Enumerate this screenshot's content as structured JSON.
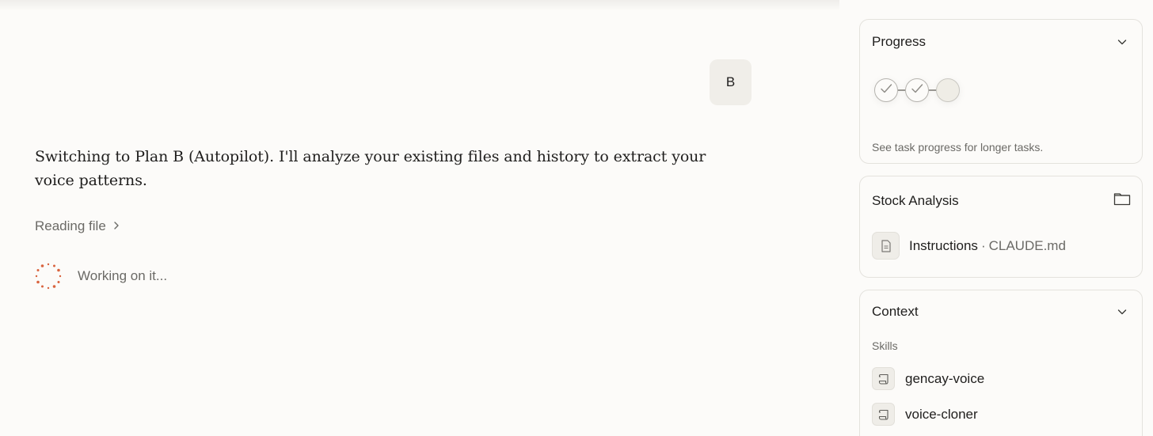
{
  "chat": {
    "user_message": "B",
    "assistant_message": "Switching to Plan B (Autopilot). I'll analyze your existing files and history to extract your voice patterns.",
    "tool_call_label": "Reading file",
    "status_text": "Working on it..."
  },
  "progress_panel": {
    "title": "Progress",
    "steps": [
      "complete",
      "complete",
      "pending"
    ],
    "hint": "See task progress for longer tasks."
  },
  "project_panel": {
    "title": "Stock Analysis",
    "file": {
      "name": "Instructions",
      "separator": "·",
      "path": "CLAUDE.md"
    }
  },
  "context_panel": {
    "title": "Context",
    "section_label": "Skills",
    "skills": [
      "gencay-voice",
      "voice-cloner"
    ]
  },
  "colors": {
    "background": "#fcfbf9",
    "spinner_accent": "#d9643f",
    "muted_text": "#6b6a66",
    "border": "#e4e2dd"
  },
  "icons": {
    "tool_call": "chevron-right-icon",
    "spinner": "loading-spinner-icon",
    "collapse": "chevron-down-icon",
    "folder": "folder-icon",
    "file": "document-icon",
    "skill": "scroll-icon",
    "step_done": "checkmark-icon"
  }
}
